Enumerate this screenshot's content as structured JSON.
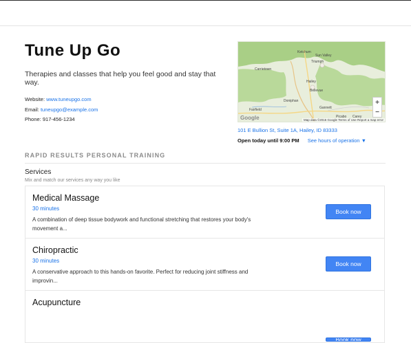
{
  "business": {
    "name": "Tune Up Go",
    "tagline": "Therapies and classes that help you feel good and stay that way.",
    "website_label": "Website:",
    "website": "www.tuneupgo.com",
    "email_label": "Email:",
    "email": "tuneupgo@example.com",
    "phone_label": "Phone:",
    "phone": "917-456-1234"
  },
  "map": {
    "places": [
      "Ketchum",
      "Sun Valley",
      "Triumph",
      "Carrietown",
      "Hailey",
      "Bellevue",
      "Doniphan",
      "Fairfield",
      "Gannett",
      "Picabo",
      "Carey"
    ],
    "zoom_in": "+",
    "zoom_out": "−",
    "google_logo": "Google",
    "footer": "Map data ©2016 Google   Terms of Use   Report a map error"
  },
  "location": {
    "address": "101 E Bullion St, Suite 1A, Hailey, ID 83333",
    "open_status": "Open today until 9:00 PM",
    "hours_link": "See hours of operation ▼"
  },
  "section": {
    "title": "RAPID RESULTS PERSONAL TRAINING",
    "services_heading": "Services",
    "services_sub": "Mix and match our services any way you like"
  },
  "services": [
    {
      "name": "Medical Massage",
      "duration": "30 minutes",
      "description": "A combination of deep tissue bodywork and functional stretching that restores your body's movement a...",
      "button": "Book now"
    },
    {
      "name": "Chiropractic",
      "duration": "30 minutes",
      "description": "A conservative approach to this hands-on favorite. Perfect for reducing joint stiffness and improvin...",
      "button": "Book now"
    },
    {
      "name": "Acupuncture",
      "duration": "",
      "description": "",
      "button": "Book now"
    }
  ],
  "colors": {
    "accent": "#4285f4",
    "link": "#1a73e8",
    "map_land": "#e8eedc",
    "map_green": "#a9cf86"
  }
}
